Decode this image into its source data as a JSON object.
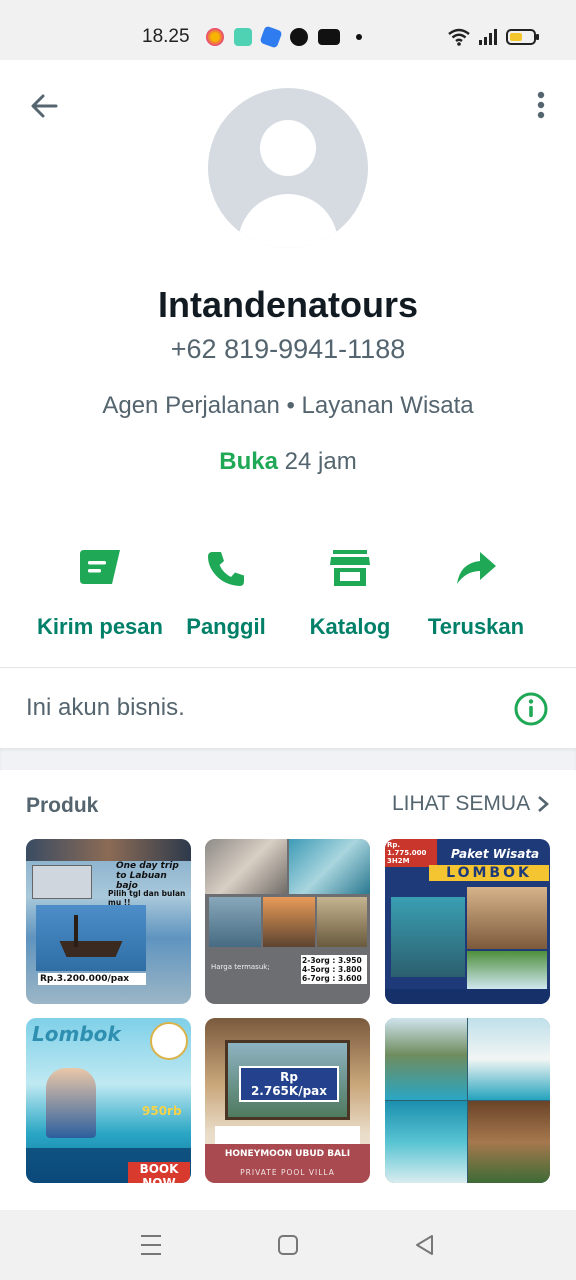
{
  "status_bar": {
    "time": "18.25",
    "app_icons": [
      "star-app-icon",
      "robot-app-icon",
      "blue-app-icon",
      "browser-app-icon",
      "youtube-icon",
      "notification-dot-icon"
    ],
    "system_icons": [
      "wifi-icon",
      "signal-icon",
      "battery-icon"
    ]
  },
  "profile": {
    "name": "Intandenatours",
    "phone": "+62 819-9941-1188",
    "category": "Agen Perjalanan • Layanan Wisata",
    "hours_status": "Buka",
    "hours_detail": " 24 jam"
  },
  "actions": [
    {
      "label": "Kirim pesan",
      "icon": "message-icon"
    },
    {
      "label": "Panggil",
      "icon": "phone-icon"
    },
    {
      "label": "Katalog",
      "icon": "store-icon"
    },
    {
      "label": "Teruskan",
      "icon": "forward-icon"
    }
  ],
  "business_note": "Ini akun bisnis.",
  "products": {
    "title": "Produk",
    "see_all": "LIHAT SEMUA",
    "tiles": [
      {
        "caption": "One day trip to Labuan bajo",
        "sub": "Pilih tgl dan bulan mu !!",
        "price": "Rp.3.200.000/pax"
      },
      {
        "caption": "Harga termasuk;",
        "sub": "2-3org : 3.950  4-5org : 3.800  6-7org : 3.600",
        "price": ""
      },
      {
        "caption": "Paket Wisata",
        "sub": "LOMBOK",
        "price": "Rp. 1.775.000 3H2M"
      },
      {
        "caption": "Lombok",
        "sub": "950rb",
        "price": "BOOK NOW"
      },
      {
        "caption": "HONEYMOON UBUD BALI",
        "sub": "PRIVATE POOL VILLA",
        "price": "Rp 2.765K/pax"
      },
      {
        "caption": "",
        "sub": "",
        "price": ""
      }
    ]
  },
  "colors": {
    "accent": "#008069",
    "open": "#1fa855",
    "text_secondary": "#54656f"
  }
}
